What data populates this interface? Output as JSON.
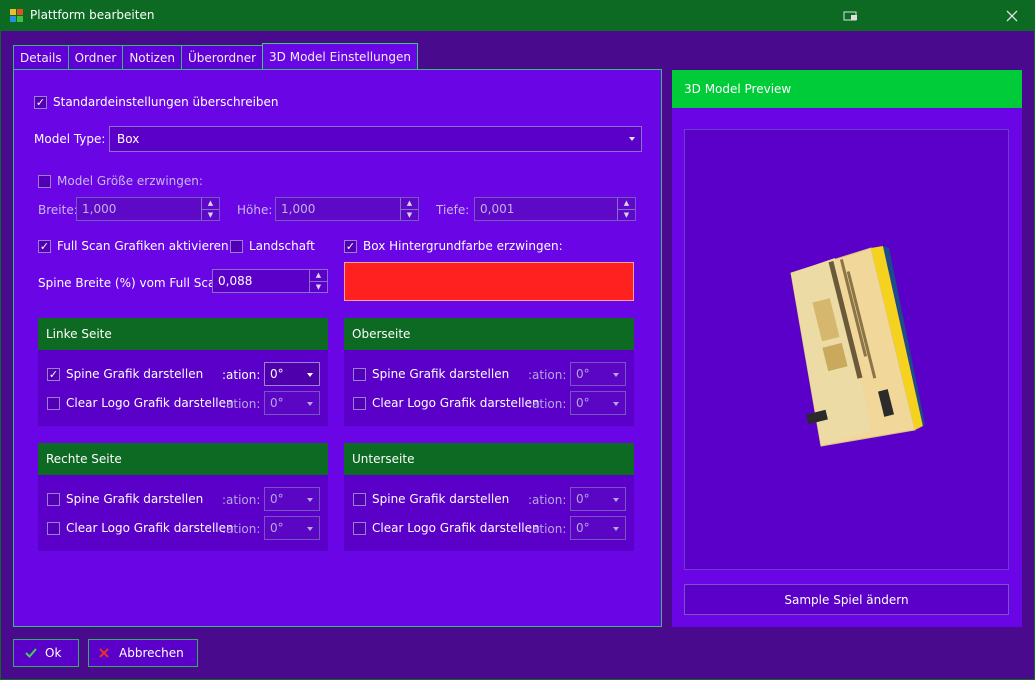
{
  "window": {
    "title": "Plattform bearbeiten"
  },
  "tabs": [
    {
      "label": "Details"
    },
    {
      "label": "Ordner"
    },
    {
      "label": "Notizen"
    },
    {
      "label": "Überordner"
    },
    {
      "label": "3D Model Einstellungen"
    }
  ],
  "settings": {
    "override_label": "Standardeinstellungen überschreiben",
    "override_checked": true,
    "model_type_label": "Model Type:",
    "model_type_value": "Box",
    "force_size_label": "Model Größe erzwingen:",
    "force_size_checked": false,
    "width_label": "Breite:",
    "width_value": "1,000",
    "height_label": "Höhe:",
    "height_value": "1,000",
    "depth_label": "Tiefe:",
    "depth_value": "0,001",
    "full_scan_label": "Full Scan Grafiken aktivieren",
    "full_scan_checked": true,
    "landscape_label": "Landschaft",
    "landscape_checked": false,
    "force_bg_label": "Box Hintergrundfarbe erzwingen:",
    "force_bg_checked": true,
    "bg_color": "#ff2020",
    "spine_width_label": "Spine Breite (%) vom Full Scan:",
    "spine_width_value": "0,088"
  },
  "groups": {
    "left": {
      "title": "Linke Seite",
      "spine_label": "Spine Grafik darstellen",
      "spine_checked": true,
      "spine_rotation": "0°",
      "logo_label": "Clear Logo Grafik darstellen",
      "logo_checked": false,
      "logo_rotation": "0°",
      "rotation_label": ":ation:"
    },
    "top": {
      "title": "Oberseite",
      "spine_label": "Spine Grafik darstellen",
      "spine_checked": false,
      "spine_rotation": "0°",
      "logo_label": "Clear Logo Grafik darstellen",
      "logo_checked": false,
      "logo_rotation": "0°",
      "rotation_label": ":ation:"
    },
    "right": {
      "title": "Rechte Seite",
      "spine_label": "Spine Grafik darstellen",
      "spine_checked": false,
      "spine_rotation": "0°",
      "logo_label": "Clear Logo Grafik darstellen",
      "logo_checked": false,
      "logo_rotation": "0°",
      "rotation_label": ":ation:"
    },
    "bottom": {
      "title": "Unterseite",
      "spine_label": "Spine Grafik darstellen",
      "spine_checked": false,
      "spine_rotation": "0°",
      "logo_label": "Clear Logo Grafik darstellen",
      "logo_checked": false,
      "logo_rotation": "0°",
      "rotation_label": ":ation:"
    }
  },
  "preview": {
    "title": "3D Model Preview",
    "sample_button": "Sample Spiel ändern"
  },
  "footer": {
    "ok_label": "Ok",
    "cancel_label": "Abbrechen"
  },
  "colors": {
    "accent_green": "#0c6a22",
    "preview_head": "#00cc3a",
    "panel": "#6a05e6",
    "background": "#4a0a8e"
  },
  "icons": [
    "app-icon",
    "restore-icon",
    "close-icon",
    "checkmark-icon",
    "cancel-x-icon"
  ]
}
